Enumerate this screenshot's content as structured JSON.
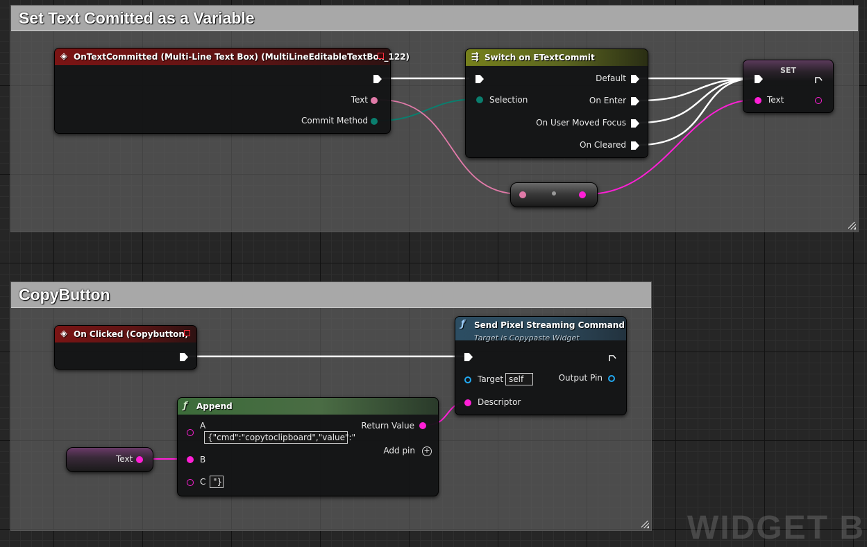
{
  "watermark": "WIDGET BP",
  "comments": {
    "top": {
      "title": "Set Text Comitted as a Variable"
    },
    "bottom": {
      "title": "CopyButton"
    }
  },
  "event_text_committed": {
    "title": "OnTextCommitted (Multi-Line Text Box) (MultiLineEditableTextBox_122)",
    "pin_text": "Text",
    "pin_commit_method": "Commit Method"
  },
  "switch_node": {
    "title": "Switch on ETextCommit",
    "pin_selection": "Selection",
    "pin_default": "Default",
    "pin_on_enter": "On Enter",
    "pin_on_user_moved_focus": "On User Moved Focus",
    "pin_on_cleared": "On Cleared"
  },
  "set_node": {
    "title": "SET",
    "pin_text": "Text"
  },
  "event_clicked": {
    "title": "On Clicked (Copybutton)"
  },
  "send_command": {
    "title": "Send Pixel Streaming Command",
    "subtitle": "Target is Copypaste Widget",
    "pin_target": "Target",
    "target_value": "self",
    "pin_output": "Output Pin",
    "pin_descriptor": "Descriptor"
  },
  "append_node": {
    "title": "Append",
    "pin_a": "A",
    "a_value": "{\"cmd\":\"copytoclipboard\",\"value\":\"",
    "pin_b": "B",
    "pin_c": "C",
    "c_value": "\"}",
    "pin_return": "Return Value",
    "add_pin": "Add pin"
  },
  "get_text_node": {
    "label": "Text"
  },
  "colors": {
    "exec": "#ffffff",
    "text_pin": "#ff1fd6",
    "text_pin_light": "#e07aa8",
    "enum_pin": "#0a7e6e",
    "object_pin": "#22a8f0",
    "event_header": "#7a1414",
    "switch_header": "#76801c",
    "function_header": "#2c4d62",
    "pure_header": "#3c6c3a"
  }
}
